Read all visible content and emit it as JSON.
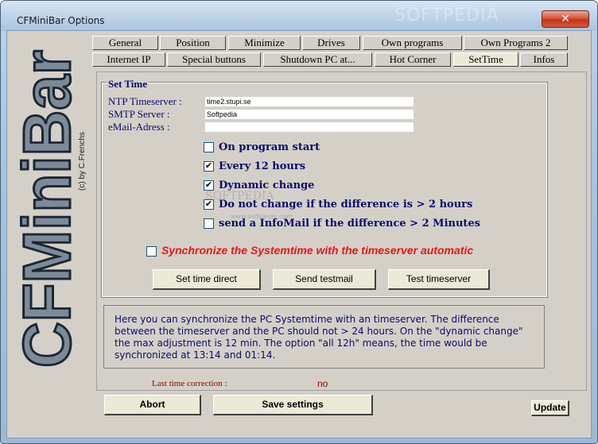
{
  "window": {
    "title": "CFMiniBar Options",
    "watermark": "SOFTPEDIA",
    "close_glyph": "✕"
  },
  "logo": {
    "text": "CFMiniBar",
    "credit": "(c) by C.Frenchs"
  },
  "tabs_row1": [
    {
      "label": "General"
    },
    {
      "label": "Position"
    },
    {
      "label": "Minimize"
    },
    {
      "label": "Drives"
    },
    {
      "label": "Own programs"
    },
    {
      "label": "Own Programs 2"
    }
  ],
  "tabs_row2": [
    {
      "label": "Internet IP"
    },
    {
      "label": "Special buttons"
    },
    {
      "label": "Shutdown PC at..."
    },
    {
      "label": "Hot Corner"
    },
    {
      "label": "SetTime"
    },
    {
      "label": "Infos"
    }
  ],
  "settime": {
    "group_title": "Set Time",
    "ntp_label": "NTP Timeserver :",
    "ntp_value": "time2.stupi.se",
    "smtp_label": "SMTP Server :",
    "smtp_value": "Softpedia",
    "email_label": "eMail-Adress :",
    "email_value": "",
    "options": [
      {
        "label": "On program start",
        "checked": false
      },
      {
        "label": "Every 12 hours",
        "checked": true
      },
      {
        "label": "Dynamic change",
        "checked": true
      },
      {
        "label": "Do not change if the difference is > 2 hours",
        "checked": true
      },
      {
        "label": "send a InfoMail if the difference > 2 Minutes",
        "checked": false
      }
    ],
    "sync_label": "Synchronize the Systemtime with the timeserver automatic",
    "sync_checked": false,
    "check_glyph": "✔",
    "watermark_center": "SOFTPEDIA",
    "watermark_url": "www.softpedia.com",
    "buttons": {
      "set_time": "Set time direct",
      "send_testmail": "Send testmail",
      "test_timeserver": "Test timeserver"
    },
    "info_text": "Here you can synchronize the PC Systemtime with an timeserver. The difference between the timeserver and the PC should not > 24 hours. On the \"dynamic change\" the max adjustment is 12 min. The option \"all 12h\" means, the time would be synchronized at 13:14 and 01:14.",
    "last_correction_label": "Last time correction :",
    "last_correction_value": "no"
  },
  "footer": {
    "abort": "Abort",
    "save": "Save settings",
    "update": "Update"
  },
  "colors": {
    "label_blue": "#0a0a6e",
    "warning_red": "#e8141e",
    "dialog_gray": "#d4d0c8"
  }
}
